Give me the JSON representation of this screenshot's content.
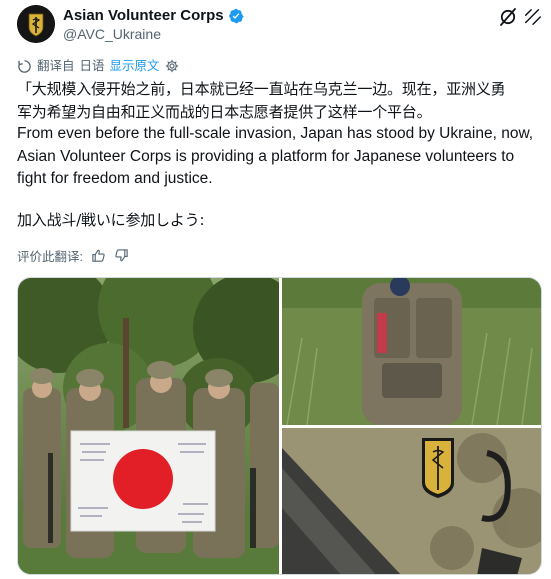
{
  "account": {
    "display_name": "Asian Volunteer Corps",
    "handle": "@AVC_Ukraine",
    "verified": true,
    "avatar_icon": "avc-logo-icon"
  },
  "header_actions": {
    "grok_icon": "grok-icon",
    "more_icon": "more-icon"
  },
  "translation": {
    "label": "翻译自",
    "source_language": "日语",
    "show_original": "显示原文",
    "settings_icon": "gear-icon"
  },
  "tweet": {
    "zh_line_1": "「大规模入侵开始之前，日本就已经一直站在乌克兰一边。现在，亚洲义勇",
    "zh_line_2": "军为希望为自由和正义而战的日本志愿者提供了这样一个平台。",
    "en_line_1": "From even before the full-scale invasion, Japan has stood by Ukraine, now,",
    "en_line_2": "Asian Volunteer Corps is providing a platform for Japanese volunteers to",
    "en_line_3": "fight for freedom and justice.",
    "cta": "加入战斗/戦いに参加しよう:"
  },
  "rate_translation": {
    "label": "评价此翻译:",
    "thumbs_up_icon": "thumbs-up-icon",
    "thumbs_down_icon": "thumbs-down-icon"
  },
  "media": {
    "images": [
      {
        "id": "group-photo",
        "description_icon": "photo-icon"
      },
      {
        "id": "soldier-back-photo",
        "description_icon": "photo-icon"
      },
      {
        "id": "patch-closeup-photo",
        "description_icon": "photo-icon"
      }
    ]
  },
  "colors": {
    "text_primary": "#0f1419",
    "text_secondary": "#536471",
    "link": "#1d9bf0",
    "verified": "#1d9bf0",
    "border": "#cfd9de"
  }
}
